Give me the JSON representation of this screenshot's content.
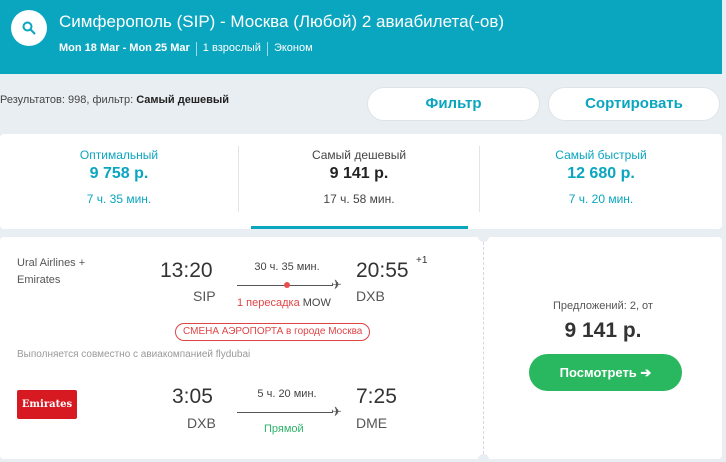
{
  "header": {
    "route_title": "Симферополь (SIP) - Москва (Любой) 2 авиабилета(-ов)",
    "dates": "Mon 18 Mar - Mon 25 Mar",
    "passengers": "1 взрослый",
    "cabin": "Эконом",
    "search_icon": "search-icon"
  },
  "toolbar": {
    "results_text": "Результатов: 998, фильтр:",
    "filter_value": "Самый дешевый",
    "filter_button": "Фильтр",
    "sort_button": "Сортировать"
  },
  "tabs": [
    {
      "label": "Оптимальный",
      "price": "9 758 р.",
      "duration": "7 ч. 35 мин."
    },
    {
      "label": "Самый дешевый",
      "price": "9 141 р.",
      "duration": "17 ч. 58 мин."
    },
    {
      "label": "Самый быстрый",
      "price": "12 680 р.",
      "duration": "7 ч. 20 мин."
    }
  ],
  "result": {
    "airlines": "Ural Airlines + Emirates",
    "leg1": {
      "depart_time": "13:20",
      "depart_code": "SIP",
      "duration": "30 ч. 35 мин.",
      "stops": "1 пересадка",
      "via": "MOW",
      "arrive_time": "20:55",
      "next_day": "+1",
      "arrive_code": "DXB"
    },
    "airport_change": "СМЕНА АЭРОПОРТА в городе Москва",
    "operated_by": "Выполняется совместно с авиакомпанией flydubai",
    "leg2": {
      "logo_text": "Emirates",
      "depart_time": "3:05",
      "depart_code": "DXB",
      "duration": "5 ч. 20 мин.",
      "stops": "Прямой",
      "arrive_time": "7:25",
      "arrive_code": "DME"
    },
    "offers": "Предложений: 2, от",
    "price": "9 141 р.",
    "view_button": "Посмотреть ➔"
  },
  "colors": {
    "brand": "#0aa5bf",
    "cta": "#29b85f",
    "stop_red": "#e04545",
    "direct_green": "#2db36a",
    "emirates_red": "#d71a21"
  }
}
